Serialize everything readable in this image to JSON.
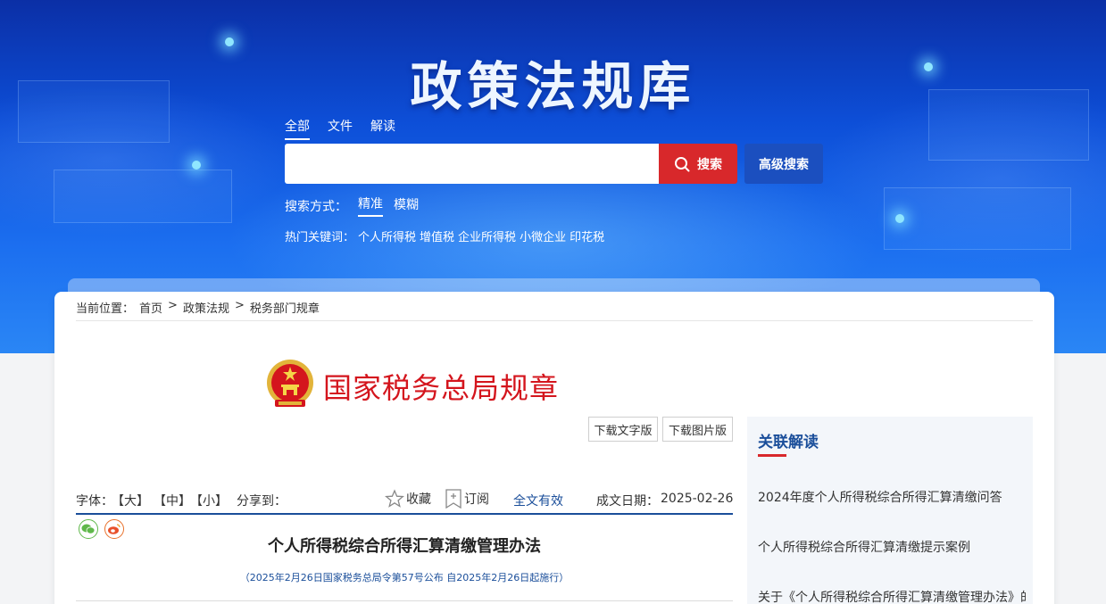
{
  "hero": {
    "title": "政策法规库",
    "scope_tabs": [
      "全部",
      "文件",
      "解读"
    ],
    "search_placeholder": "",
    "search_button": "搜索",
    "advanced_button": "高级搜索",
    "mode_label": "搜索方式：",
    "modes": [
      "精准",
      "模糊"
    ],
    "hot_label": "热门关键词：",
    "hot_keywords": [
      "个人所得税",
      "增值税",
      "企业所得税",
      "小微企业",
      "印花税"
    ]
  },
  "breadcrumb": {
    "label": "当前位置：",
    "items": [
      "首页",
      "政策法规",
      "税务部门规章"
    ],
    "separator": ">"
  },
  "agency": {
    "title": "国家税务总局规章",
    "emblem_icon": "national-emblem-icon"
  },
  "downloads": {
    "text_version": "下载文字版",
    "image_version": "下载图片版"
  },
  "toolbar": {
    "font_label": "字体：",
    "font_large": "【大】",
    "font_medium": "【中】",
    "font_small": "【小】",
    "share_label": "分享到：",
    "favorite": "收藏",
    "subscribe": "订阅",
    "validity": "全文有效",
    "date_label": "成文日期：",
    "date": "2025-02-26"
  },
  "share_icons": [
    "wechat-icon",
    "weibo-icon"
  ],
  "document": {
    "title": "个人所得税综合所得汇算清缴管理办法",
    "subtitle": "（2025年2月26日国家税务总局令第57号公布 自2025年2月26日起施行）"
  },
  "related": {
    "title": "关联解读",
    "items": [
      "2024年度个人所得税综合所得汇算清缴问答",
      "个人所得税综合所得汇算清缴提示案例",
      "关于《个人所得税综合所得汇算清缴管理办法》的解读"
    ]
  },
  "colors": {
    "accent_red": "#d8282b",
    "brand_blue": "#1a4e9a",
    "hero_blue": "#0d4fd8"
  }
}
